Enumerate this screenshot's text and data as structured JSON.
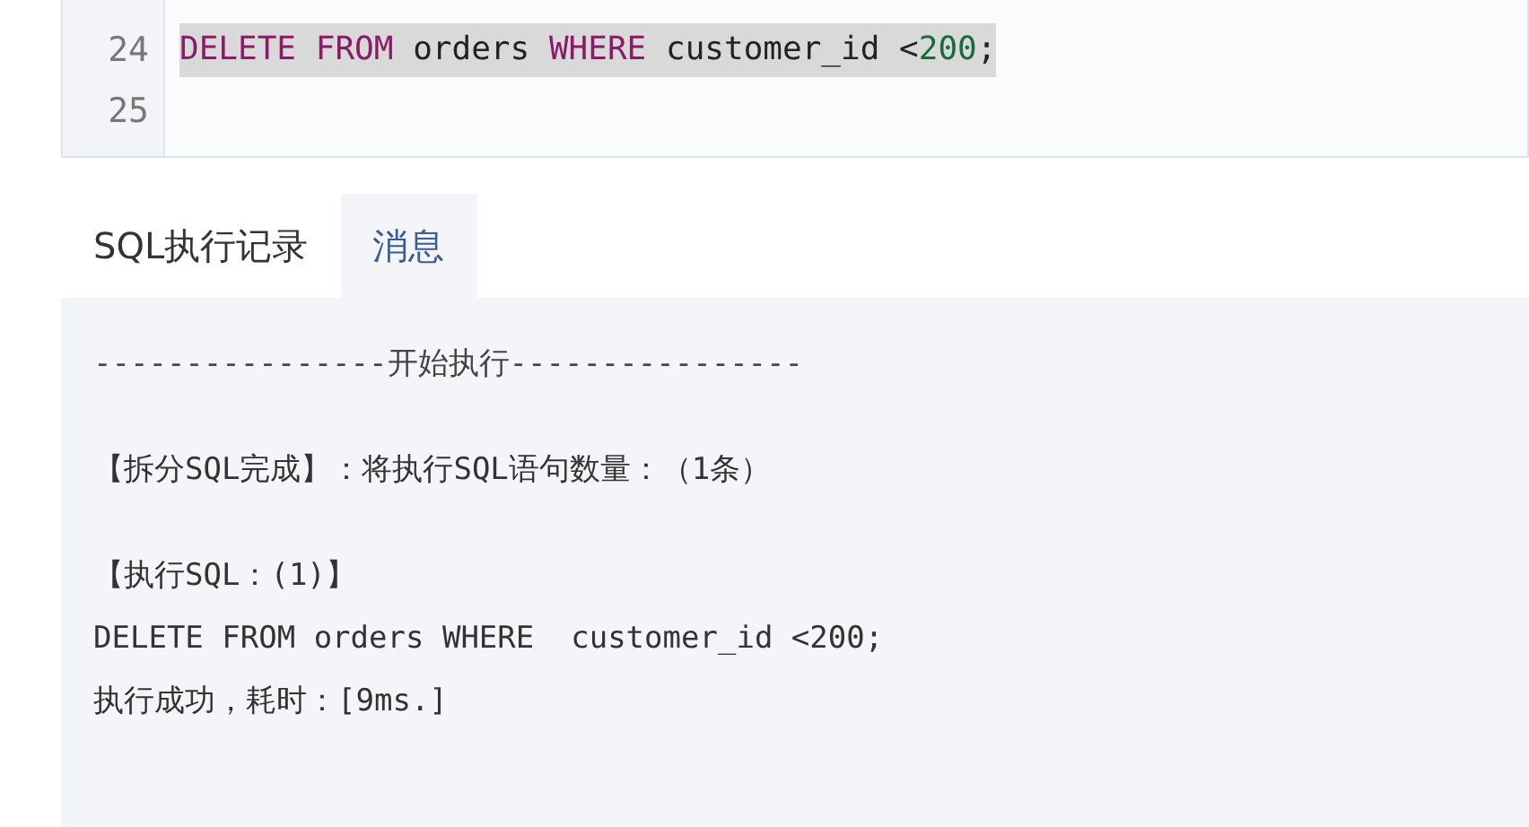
{
  "editor": {
    "lines": [
      {
        "number": "24",
        "selected": true,
        "tokens": [
          {
            "kind": "keyword",
            "text": "DELETE"
          },
          {
            "kind": "keyword",
            "text": "FROM"
          },
          {
            "kind": "plain",
            "text": "orders"
          },
          {
            "kind": "keyword",
            "text": "WHERE"
          },
          {
            "kind": "plain",
            "text": " customer_id <"
          },
          {
            "kind": "number",
            "text": "200"
          },
          {
            "kind": "punct",
            "text": ";"
          }
        ]
      },
      {
        "number": "25"
      }
    ]
  },
  "tabs": [
    {
      "label": "SQL执行记录",
      "selected": false
    },
    {
      "label": "消息",
      "selected": true
    }
  ],
  "messages": [
    {
      "kind": "divider",
      "text": "----------------开始执行----------------"
    },
    {
      "kind": "blank"
    },
    {
      "kind": "text",
      "text": "【拆分SQL完成】：将执行SQL语句数量：（1条）"
    },
    {
      "kind": "blank"
    },
    {
      "kind": "text",
      "text": "【执行SQL：(1)】"
    },
    {
      "kind": "text",
      "text": "DELETE FROM orders WHERE  customer_id <200;"
    },
    {
      "kind": "text",
      "text": "执行成功，耗时：[9ms.]"
    }
  ]
}
